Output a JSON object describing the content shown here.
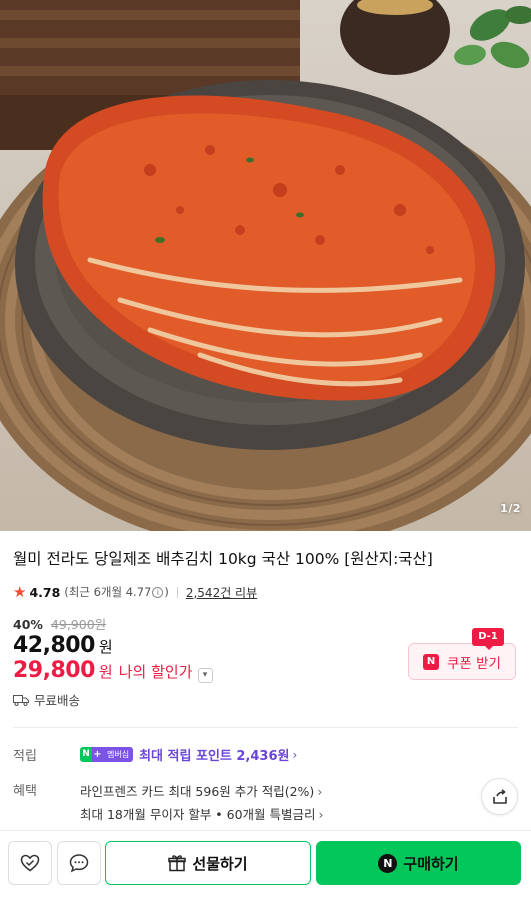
{
  "gallery": {
    "image_alt": "배추김치 상품 이미지",
    "counter_current": "1",
    "counter_total": "2",
    "counter_text": "1/2"
  },
  "product": {
    "title": "월미 전라도 당일제조 배추김치 10kg 국산 100% [원산지:국산]",
    "rating": "4.78",
    "recent_rating_prefix": "(최근 6개월 4.77",
    "recent_rating_suffix": ")",
    "review_count_text": "2,542건 리뷰",
    "discount_rate": "40%",
    "original_price": "49,900원",
    "sale_price": "42,800",
    "currency": "원",
    "my_price": "29,800",
    "my_price_label": "나의 할인가",
    "shipping": "무료배송"
  },
  "coupon": {
    "badge": "D-1",
    "icon_letter": "N",
    "label": "쿠폰 받기"
  },
  "points": {
    "label": "적립",
    "badge_n": "N",
    "badge_plus": "+",
    "badge_text": "멤버십",
    "text": "최대 적립 포인트 2,436원"
  },
  "benefits": {
    "label": "혜택",
    "line1": "라인프렌즈 카드 최대 596원 추가 적립(2%)",
    "line2": "최대 18개월 무이자 할부 • 60개월 특별금리"
  },
  "actions": {
    "gift_label": "선물하기",
    "buy_label": "구매하기",
    "buy_icon_letter": "N"
  },
  "colors": {
    "accent_red": "#ee1c44",
    "naver_green": "#03c75a",
    "point_purple": "#6a45d9"
  },
  "icons": [
    "star-icon",
    "info-icon",
    "chevron-down-icon",
    "truck-icon",
    "chevron-right-icon",
    "share-icon",
    "heart-check-icon",
    "chat-icon",
    "gift-icon"
  ]
}
